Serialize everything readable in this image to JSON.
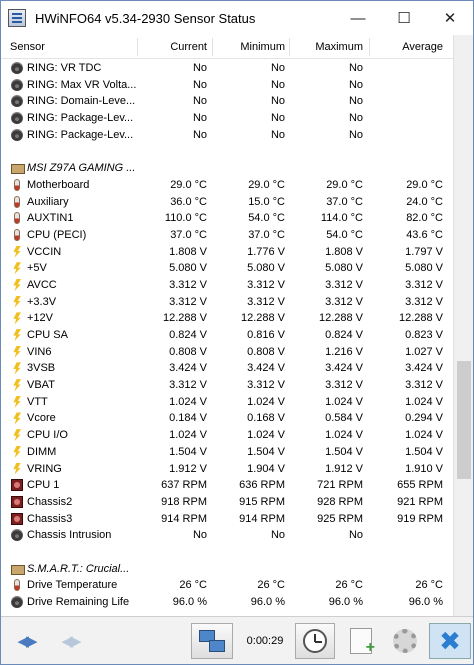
{
  "window": {
    "title": "HWiNFO64 v5.34-2930 Sensor Status"
  },
  "columns": {
    "sensor": "Sensor",
    "current": "Current",
    "minimum": "Minimum",
    "maximum": "Maximum",
    "average": "Average"
  },
  "rows": [
    {
      "icon": "gauge",
      "label": "RING: VR TDC",
      "cur": "No",
      "min": "No",
      "max": "No",
      "avg": ""
    },
    {
      "icon": "gauge",
      "label": "RING: Max VR Volta...",
      "cur": "No",
      "min": "No",
      "max": "No",
      "avg": ""
    },
    {
      "icon": "gauge",
      "label": "RING: Domain-Leve...",
      "cur": "No",
      "min": "No",
      "max": "No",
      "avg": ""
    },
    {
      "icon": "gauge",
      "label": "RING: Package-Lev...",
      "cur": "No",
      "min": "No",
      "max": "No",
      "avg": ""
    },
    {
      "icon": "gauge",
      "label": "RING: Package-Lev...",
      "cur": "No",
      "min": "No",
      "max": "No",
      "avg": ""
    },
    {
      "type": "blank"
    },
    {
      "type": "group",
      "label": "MSI Z97A GAMING ..."
    },
    {
      "icon": "therm",
      "label": "Motherboard",
      "cur": "29.0 °C",
      "min": "29.0 °C",
      "max": "29.0 °C",
      "avg": "29.0 °C"
    },
    {
      "icon": "therm",
      "label": "Auxiliary",
      "cur": "36.0 °C",
      "min": "15.0 °C",
      "max": "37.0 °C",
      "avg": "24.0 °C"
    },
    {
      "icon": "therm",
      "label": "AUXTIN1",
      "cur": "110.0 °C",
      "min": "54.0 °C",
      "max": "114.0 °C",
      "avg": "82.0 °C"
    },
    {
      "icon": "therm",
      "label": "CPU (PECI)",
      "cur": "37.0 °C",
      "min": "37.0 °C",
      "max": "54.0 °C",
      "avg": "43.6 °C"
    },
    {
      "icon": "volt",
      "label": "VCCIN",
      "cur": "1.808 V",
      "min": "1.776 V",
      "max": "1.808 V",
      "avg": "1.797 V"
    },
    {
      "icon": "volt",
      "label": "+5V",
      "cur": "5.080 V",
      "min": "5.080 V",
      "max": "5.080 V",
      "avg": "5.080 V"
    },
    {
      "icon": "volt",
      "label": "AVCC",
      "cur": "3.312 V",
      "min": "3.312 V",
      "max": "3.312 V",
      "avg": "3.312 V"
    },
    {
      "icon": "volt",
      "label": "+3.3V",
      "cur": "3.312 V",
      "min": "3.312 V",
      "max": "3.312 V",
      "avg": "3.312 V"
    },
    {
      "icon": "volt",
      "label": "+12V",
      "cur": "12.288 V",
      "min": "12.288 V",
      "max": "12.288 V",
      "avg": "12.288 V"
    },
    {
      "icon": "volt",
      "label": "CPU SA",
      "cur": "0.824 V",
      "min": "0.816 V",
      "max": "0.824 V",
      "avg": "0.823 V"
    },
    {
      "icon": "volt",
      "label": "VIN6",
      "cur": "0.808 V",
      "min": "0.808 V",
      "max": "1.216 V",
      "avg": "1.027 V"
    },
    {
      "icon": "volt",
      "label": "3VSB",
      "cur": "3.424 V",
      "min": "3.424 V",
      "max": "3.424 V",
      "avg": "3.424 V"
    },
    {
      "icon": "volt",
      "label": "VBAT",
      "cur": "3.312 V",
      "min": "3.312 V",
      "max": "3.312 V",
      "avg": "3.312 V"
    },
    {
      "icon": "volt",
      "label": "VTT",
      "cur": "1.024 V",
      "min": "1.024 V",
      "max": "1.024 V",
      "avg": "1.024 V"
    },
    {
      "icon": "volt",
      "label": "Vcore",
      "cur": "0.184 V",
      "min": "0.168 V",
      "max": "0.584 V",
      "avg": "0.294 V"
    },
    {
      "icon": "volt",
      "label": "CPU I/O",
      "cur": "1.024 V",
      "min": "1.024 V",
      "max": "1.024 V",
      "avg": "1.024 V"
    },
    {
      "icon": "volt",
      "label": "DIMM",
      "cur": "1.504 V",
      "min": "1.504 V",
      "max": "1.504 V",
      "avg": "1.504 V"
    },
    {
      "icon": "volt",
      "label": "VRING",
      "cur": "1.912 V",
      "min": "1.904 V",
      "max": "1.912 V",
      "avg": "1.910 V"
    },
    {
      "icon": "fan",
      "label": "CPU 1",
      "cur": "637 RPM",
      "min": "636 RPM",
      "max": "721 RPM",
      "avg": "655 RPM"
    },
    {
      "icon": "fan",
      "label": "Chassis2",
      "cur": "918 RPM",
      "min": "915 RPM",
      "max": "928 RPM",
      "avg": "921 RPM"
    },
    {
      "icon": "fan",
      "label": "Chassis3",
      "cur": "914 RPM",
      "min": "914 RPM",
      "max": "925 RPM",
      "avg": "919 RPM"
    },
    {
      "icon": "gauge",
      "label": "Chassis Intrusion",
      "cur": "No",
      "min": "No",
      "max": "No",
      "avg": ""
    },
    {
      "type": "blank"
    },
    {
      "type": "group",
      "label": "S.M.A.R.T.: Crucial..."
    },
    {
      "icon": "therm",
      "label": "Drive Temperature",
      "cur": "26 °C",
      "min": "26 °C",
      "max": "26 °C",
      "avg": "26 °C"
    },
    {
      "icon": "gauge",
      "label": "Drive Remaining Life",
      "cur": "96.0 %",
      "min": "96.0 %",
      "max": "96.0 %",
      "avg": "96.0 %"
    }
  ],
  "toolbar": {
    "timer": "0:00:29"
  }
}
